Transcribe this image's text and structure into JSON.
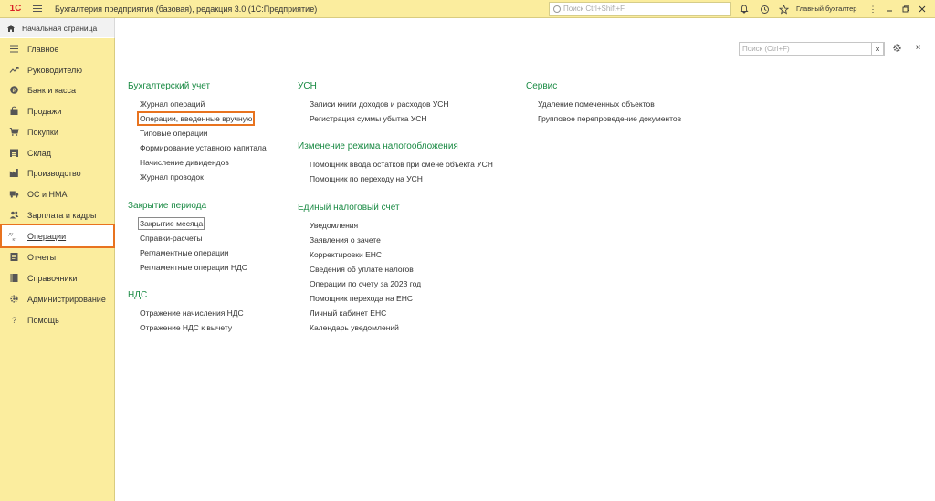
{
  "titlebar": {
    "logo": "1С",
    "title": "Бухгалтерия предприятия (базовая), редакция 3.0  (1С:Предприятие)",
    "search_placeholder": "Поиск Ctrl+Shift+F",
    "user": "Главный бухгалтер",
    "icons": [
      "bell-icon",
      "history-icon",
      "star-icon",
      "menu-icon",
      "minimize-icon",
      "restore-icon",
      "close-icon"
    ]
  },
  "tabs": {
    "home": "Начальная страница"
  },
  "sidebar": {
    "items": [
      {
        "label": "Главное",
        "icon": "list-icon"
      },
      {
        "label": "Руководителю",
        "icon": "trend-icon"
      },
      {
        "label": "Банк и касса",
        "icon": "coin-icon"
      },
      {
        "label": "Продажи",
        "icon": "bag-icon"
      },
      {
        "label": "Покупки",
        "icon": "cart-icon"
      },
      {
        "label": "Склад",
        "icon": "warehouse-icon"
      },
      {
        "label": "Производство",
        "icon": "factory-icon"
      },
      {
        "label": "ОС и НМА",
        "icon": "truck-icon"
      },
      {
        "label": "Зарплата и кадры",
        "icon": "people-icon"
      },
      {
        "label": "Операции",
        "icon": "debit-credit-icon",
        "active": true
      },
      {
        "label": "Отчеты",
        "icon": "report-icon"
      },
      {
        "label": "Справочники",
        "icon": "book-icon"
      },
      {
        "label": "Администрирование",
        "icon": "gear-icon"
      },
      {
        "label": "Помощь",
        "icon": "question-icon"
      }
    ]
  },
  "main": {
    "search_placeholder": "Поиск (Ctrl+F)",
    "columns": [
      {
        "groups": [
          {
            "title": "Бухгалтерский учет",
            "links": [
              "Журнал операций",
              "Операции, введенные вручную",
              "Типовые операции",
              "Формирование уставного капитала",
              "Начисление дивидендов",
              "Журнал проводок"
            ]
          },
          {
            "title": "Закрытие периода",
            "links": [
              "Закрытие месяца",
              "Справки-расчеты",
              "Регламентные операции",
              "Регламентные операции НДС"
            ]
          },
          {
            "title": "НДС",
            "links": [
              "Отражение начисления НДС",
              "Отражение НДС к вычету"
            ]
          }
        ]
      },
      {
        "groups": [
          {
            "title": "УСН",
            "links": [
              "Записи книги доходов и расходов УСН",
              "Регистрация суммы убытка УСН"
            ]
          },
          {
            "title": "Изменение режима налогообложения",
            "links": [
              "Помощник ввода остатков при смене объекта УСН",
              "Помощник по переходу на УСН"
            ]
          },
          {
            "title": "Единый налоговый счет",
            "links": [
              "Уведомления",
              "Заявления о зачете",
              "Корректировки ЕНС",
              "Сведения об уплате налогов",
              "Операции по счету за 2023 год",
              "Помощник перехода на ЕНС",
              "Личный кабинет ЕНС",
              "Календарь уведомлений"
            ]
          }
        ]
      },
      {
        "groups": [
          {
            "title": "Сервис",
            "links": [
              "Удаление помеченных объектов",
              "Групповое перепроведение документов"
            ]
          }
        ]
      }
    ]
  },
  "colors": {
    "accent_yellow": "#fbed9e",
    "group_title_green": "#198a43",
    "highlight_orange": "#e8731f"
  }
}
